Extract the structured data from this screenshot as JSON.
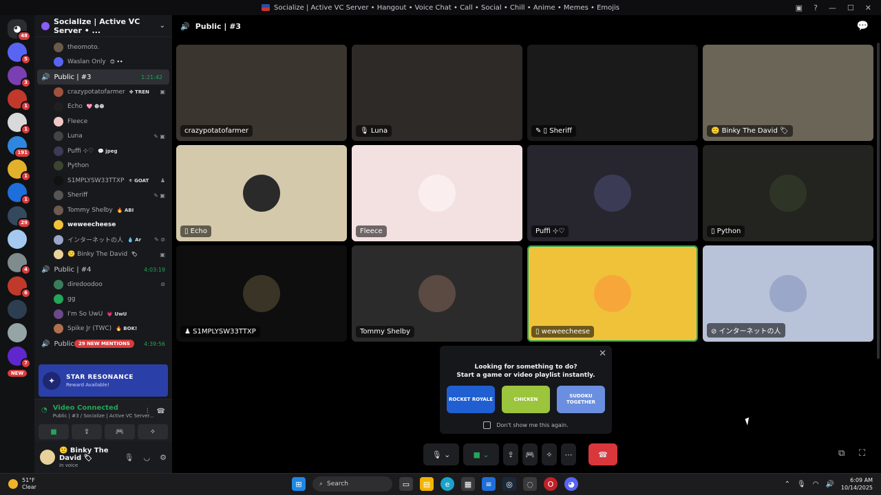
{
  "window": {
    "title": "Socialize | Active VC Server • Hangout • Voice Chat • Call • Social • Chill • Anime • Memes • Emojis"
  },
  "rail": {
    "servers": [
      {
        "color": "#2b2d31",
        "badge": "48",
        "dm": true
      },
      {
        "color": "#5865f2",
        "badge": "5"
      },
      {
        "color": "#7a3fb0",
        "badge": "3"
      },
      {
        "color": "#c0392b",
        "badge": "1"
      },
      {
        "color": "#d9d9d9",
        "badge": "1"
      },
      {
        "color": "#2e86de",
        "badge": "191"
      },
      {
        "color": "#e1b12c",
        "badge": "1"
      },
      {
        "color": "#1e6fd9",
        "badge": "1"
      },
      {
        "color": "#34495e",
        "badge": "29"
      },
      {
        "color": "#a4c8f0",
        "badge": ""
      },
      {
        "color": "#7f8c8d",
        "badge": "4"
      },
      {
        "color": "#c0392b",
        "badge": "6"
      },
      {
        "color": "#2c3e50",
        "badge": ""
      },
      {
        "color": "#95a5a6",
        "badge": ""
      },
      {
        "color": "#5f27cd",
        "badge": "7"
      }
    ],
    "new_label": "NEW"
  },
  "sidebar": {
    "server_name": "Socialize | Active VC Server • ...",
    "top_users": [
      {
        "name": "theomoto.",
        "tag": "",
        "color": "#6b5a4a"
      },
      {
        "name": "Waslan Only",
        "tag": "😊 ••",
        "color": "#5865f2"
      }
    ],
    "vc3": {
      "name": "Public | #3",
      "time": "1:21:42"
    },
    "vc3_users": [
      {
        "name": "crazypotatofarmer",
        "tag": "✤ TREN",
        "color": "#a0523d",
        "ico": "▣"
      },
      {
        "name": "Echo",
        "tag": "🩷 ☻☻",
        "color": "#1f1f1f",
        "ico": ""
      },
      {
        "name": "Fleece",
        "tag": "",
        "color": "#f3c6c6",
        "ico": ""
      },
      {
        "name": "Luna",
        "tag": "",
        "color": "#444",
        "ico": "✎ ▣"
      },
      {
        "name": "Puffi ⊹♡",
        "tag": "💬 jpeg",
        "color": "#3b3b55",
        "ico": ""
      },
      {
        "name": "Python",
        "tag": "",
        "color": "#3c4432",
        "ico": ""
      },
      {
        "name": "S1MPLYSW33TTXP",
        "tag": "⚜ GOAT",
        "color": "#111",
        "ico": "♟"
      },
      {
        "name": "Sheriff",
        "tag": "",
        "color": "#555",
        "ico": "✎ ▣"
      },
      {
        "name": "Tommy Shelby",
        "tag": "🔥 ABI",
        "color": "#6e5a50",
        "ico": ""
      },
      {
        "name": "weweecheese",
        "tag": "",
        "color": "#f0c23a",
        "ico": "",
        "bright": true
      },
      {
        "name": "インターネットの人",
        "tag": "💧 Ar",
        "color": "#9aa7c9",
        "ico": "✎ ⊘"
      },
      {
        "name": "🙁 Binky The David",
        "tag": "🏷",
        "color": "#e8d29c",
        "ico": "▣"
      }
    ],
    "vc4": {
      "name": "Public | #4",
      "time": "4:03:19"
    },
    "vc4_users": [
      {
        "name": "diredoodoo",
        "tag": "",
        "color": "#3a7d5c",
        "ico": "⊘"
      },
      {
        "name": "gg",
        "tag": "",
        "color": "#23a55a",
        "ico": ""
      },
      {
        "name": "I'm So UwU",
        "tag": "💗 UwU",
        "color": "#6a4a8a",
        "ico": ""
      },
      {
        "name": "Spike Jr (TWC)",
        "tag": "🔥 BOK!",
        "color": "#b07050",
        "ico": ""
      }
    ],
    "vc5": {
      "name": "Public",
      "time": "4:39:56",
      "mentions": "29 NEW MENTIONS"
    },
    "promo": {
      "title": "STAR RESONANCE",
      "sub": "Reward Available!"
    },
    "voice": {
      "status": "Video Connected",
      "detail": "Public | #3 / Socialize | Active VC Server..."
    },
    "user": {
      "name": "🙁 Binky The David 🏷",
      "status": "In voice"
    }
  },
  "main": {
    "channel": "Public | #3",
    "tiles": [
      {
        "label": "crazypotatofarmer",
        "bg": "#3a352f",
        "av": "",
        "speaking": false
      },
      {
        "label": "🎙 Luna",
        "bg": "#2d2a28",
        "av": "",
        "speaking": false
      },
      {
        "label": "✎ ▯ Sheriff",
        "bg": "#1a1a1a",
        "av": "",
        "speaking": false
      },
      {
        "label": "🙁 Binky The David 🏷",
        "bg": "#6b6558",
        "av": "",
        "speaking": false
      },
      {
        "label": "▯ Echo",
        "bg": "#d4c9ab",
        "av": "#2a2a2a",
        "speaking": false
      },
      {
        "label": "Fleece",
        "bg": "#f3e1e2",
        "av": "#fbeeee",
        "speaking": false
      },
      {
        "label": "Puffi ⊹♡",
        "bg": "#27252e",
        "av": "#3b3b55",
        "speaking": false
      },
      {
        "label": "▯ Python",
        "bg": "#23241f",
        "av": "#2f3526",
        "speaking": false
      },
      {
        "label": "♟ S1MPLYSW33TTXP",
        "bg": "#0e0e0e",
        "av": "#3a3426",
        "speaking": false
      },
      {
        "label": "Tommy Shelby",
        "bg": "#2c2b2c",
        "av": "#5a4a42",
        "speaking": false
      },
      {
        "label": "▯ weweecheese",
        "bg": "#f0c23a",
        "av": "#f7a73a",
        "speaking": true
      },
      {
        "label": "⊘ インターネットの人",
        "bg": "#b8c2d8",
        "av": "#9aa7c9",
        "speaking": false
      }
    ],
    "activity": {
      "line1": "Looking for something to do?",
      "line2": "Start a game or video playlist instantly.",
      "games": [
        {
          "name": "ROCKET ROYALE",
          "color": "#1f5fd1"
        },
        {
          "name": "CHICKEN",
          "color": "#9bc53d"
        },
        {
          "name": "SUDOKU TOGETHER",
          "color": "#6b8fe0"
        }
      ],
      "dont": "Don't show me this again."
    }
  },
  "taskbar": {
    "weather": {
      "temp": "51°F",
      "cond": "Clear"
    },
    "search": "Search",
    "time": "6:09 AM",
    "date": "10/14/2025"
  }
}
